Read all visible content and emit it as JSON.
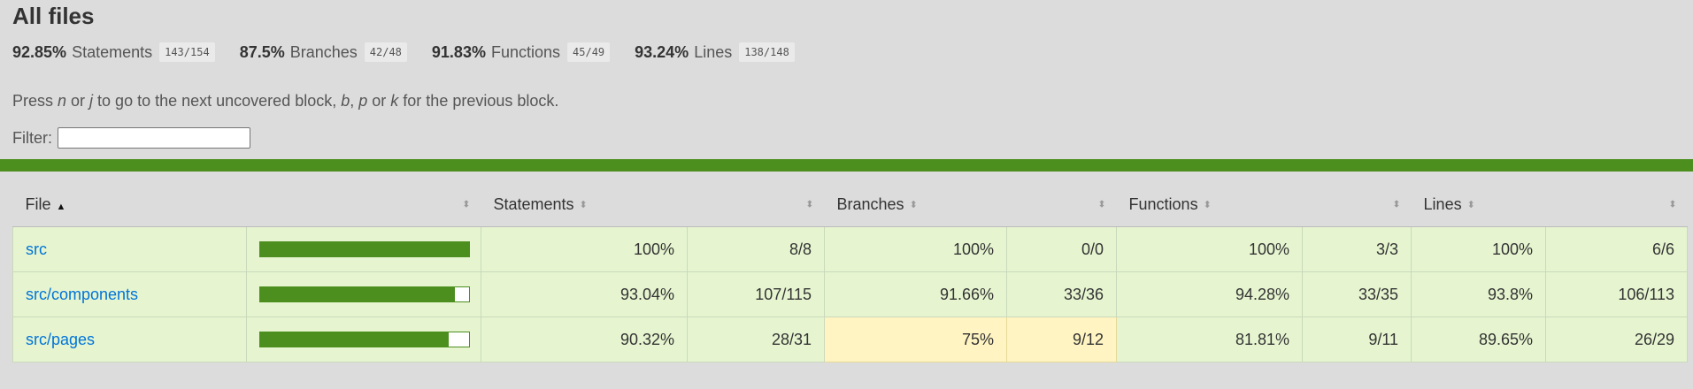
{
  "title": "All files",
  "summary": [
    {
      "pct": "92.85%",
      "name": "Statements",
      "frac": "143/154"
    },
    {
      "pct": "87.5%",
      "name": "Branches",
      "frac": "42/48"
    },
    {
      "pct": "91.83%",
      "name": "Functions",
      "frac": "45/49"
    },
    {
      "pct": "93.24%",
      "name": "Lines",
      "frac": "138/148"
    }
  ],
  "hint": {
    "t1": "Press ",
    "k1": "n",
    "t2": " or ",
    "k2": "j",
    "t3": " to go to the next uncovered block, ",
    "k3": "b",
    "t4": ", ",
    "k4": "p",
    "t5": " or ",
    "k5": "k",
    "t6": " for the previous block."
  },
  "filter_label": "Filter:",
  "filter_value": "",
  "columns": {
    "file": "File",
    "statements": "Statements",
    "branches": "Branches",
    "functions": "Functions",
    "lines": "Lines"
  },
  "rows": [
    {
      "file": "src",
      "coverage": 1.0,
      "stmt_pct": "100%",
      "stmt_frac": "8/8",
      "br_pct": "100%",
      "br_frac": "0/0",
      "fn_pct": "100%",
      "fn_frac": "3/3",
      "ln_pct": "100%",
      "ln_frac": "6/6",
      "status": "high"
    },
    {
      "file": "src/components",
      "coverage": 0.9304,
      "stmt_pct": "93.04%",
      "stmt_frac": "107/115",
      "br_pct": "91.66%",
      "br_frac": "33/36",
      "fn_pct": "94.28%",
      "fn_frac": "33/35",
      "ln_pct": "93.8%",
      "ln_frac": "106/113",
      "status": "high"
    },
    {
      "file": "src/pages",
      "coverage": 0.9032,
      "stmt_pct": "90.32%",
      "stmt_frac": "28/31",
      "br_pct": "75%",
      "br_frac": "9/12",
      "fn_pct": "81.81%",
      "fn_frac": "9/11",
      "ln_pct": "89.65%",
      "ln_frac": "26/29",
      "status": "high",
      "branch_status": "medium"
    }
  ],
  "colors": {
    "high": "#e6f5d0",
    "medium": "#fff4c2",
    "bar_fill": "#4d8f1f",
    "link": "#0074d9"
  }
}
